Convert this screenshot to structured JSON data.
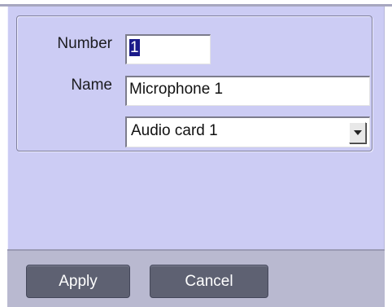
{
  "form": {
    "number_label": "Number",
    "number_value": "1",
    "name_label": "Name",
    "name_value": "Microphone 1",
    "device_selected": "Audio card 1"
  },
  "actions": {
    "apply_label": "Apply",
    "cancel_label": "Cancel"
  }
}
